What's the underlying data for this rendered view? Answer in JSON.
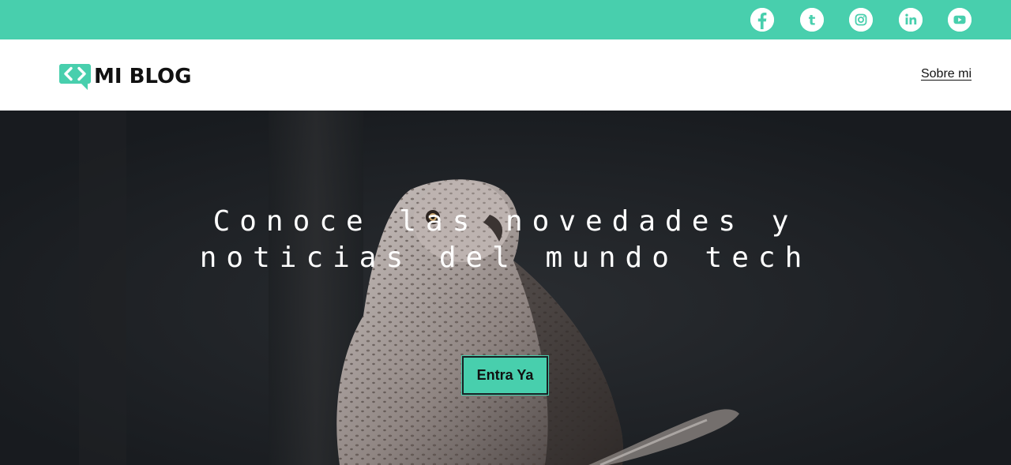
{
  "colors": {
    "accent": "#48cfad",
    "hero_bg": "#1b1e22",
    "text_dark": "#111111"
  },
  "social": [
    {
      "name": "facebook",
      "icon": "facebook-icon"
    },
    {
      "name": "tumblr",
      "icon": "tumblr-icon"
    },
    {
      "name": "instagram",
      "icon": "instagram-icon"
    },
    {
      "name": "linkedin",
      "icon": "linkedin-icon"
    },
    {
      "name": "youtube",
      "icon": "youtube-icon"
    }
  ],
  "header": {
    "logo_text": "MI BLOG",
    "logo_icon": "code-brackets-chat-icon",
    "nav": {
      "about_label": "Sobre mi"
    }
  },
  "hero": {
    "title_line1": "Conoce las novedades y",
    "title_line2": "noticias del mundo tech",
    "cta_label": "Entra Ya",
    "background": "owl-photo"
  }
}
